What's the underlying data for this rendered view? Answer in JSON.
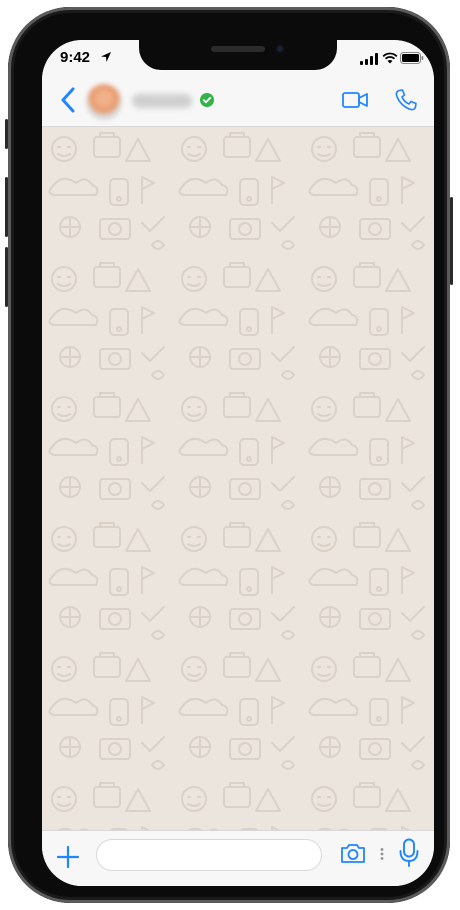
{
  "status_bar": {
    "time": "9:42"
  },
  "header": {
    "contact_name": "",
    "verified": true
  },
  "composer": {
    "message_value": "",
    "message_placeholder": ""
  },
  "colors": {
    "accent": "#1f86ff",
    "chat_background": "#ece5dd",
    "verified_badge": "#34b34a",
    "bar_background": "#f7f7f7"
  },
  "icons": {
    "back": "chevron-left-icon",
    "video_call": "video-camera-icon",
    "voice_call": "phone-icon",
    "attach": "plus-icon",
    "camera": "camera-icon",
    "microphone": "microphone-icon"
  }
}
